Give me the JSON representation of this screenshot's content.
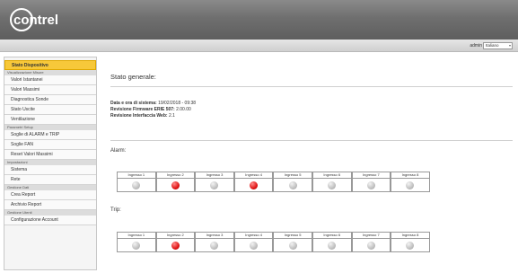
{
  "brand": {
    "name": "contrel"
  },
  "userbar": {
    "user": "admin",
    "language": "Italiano"
  },
  "sidebar": {
    "active": "Stato Dispositivo",
    "sections": [
      {
        "label": "Visualizzazione Misure"
      },
      {
        "label": "Parametri Setup"
      },
      {
        "label": "Impostazioni"
      },
      {
        "label": "Gestione Dati"
      },
      {
        "label": "Gestione Utenti"
      }
    ],
    "items": [
      "Valori Istantanei",
      "Valori Massimi",
      "Diagnostica Sonde",
      "Stato Uscite",
      "Ventilazione",
      "Soglie di ALARM e TRIP",
      "Soglie FAN",
      "Reset Valori Massimi",
      "Sistema",
      "Rete",
      "Crea Report",
      "Archivio Report",
      "Configurazione Account"
    ]
  },
  "main": {
    "title": "Stato generale:",
    "info": [
      {
        "key": "Data e ora di sistema:",
        "value": "19/02/2018 - 09:38"
      },
      {
        "key": "Revisione Firmware ERIE 507:",
        "value": "2.00.00"
      },
      {
        "key": "Revisione Interfaccia Web:",
        "value": "2.1"
      }
    ],
    "alarm": {
      "label": "Alarm:",
      "channels": [
        "Ingresso 1",
        "Ingresso 2",
        "Ingresso 3",
        "Ingresso 4",
        "Ingresso 5",
        "Ingresso 6",
        "Ingresso 7",
        "Ingresso 8"
      ],
      "states": [
        false,
        true,
        false,
        true,
        false,
        false,
        false,
        false
      ]
    },
    "trip": {
      "label": "Trip:",
      "channels": [
        "Ingresso 1",
        "Ingresso 2",
        "Ingresso 3",
        "Ingresso 4",
        "Ingresso 5",
        "Ingresso 6",
        "Ingresso 7",
        "Ingresso 8"
      ],
      "states": [
        false,
        true,
        false,
        false,
        false,
        false,
        false,
        false
      ]
    }
  },
  "colors": {
    "header": "#6f6f6f",
    "active": "#f7c83a",
    "alarm_on": "#e01515",
    "off": "#b8b8b8"
  }
}
